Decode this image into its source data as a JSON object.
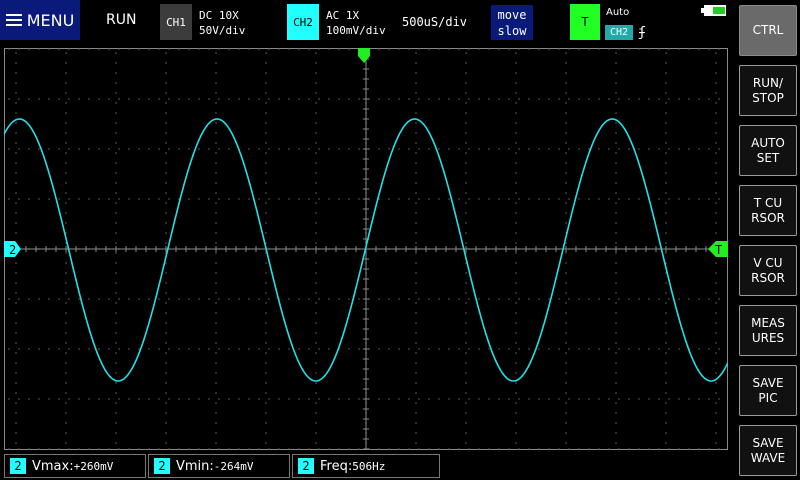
{
  "topbar": {
    "menu_label": "MENU",
    "run_state": "RUN",
    "ch1": {
      "label": "CH1",
      "coupling": "DC  10X",
      "scale": "50V/div"
    },
    "ch2": {
      "label": "CH2",
      "coupling": "AC  1X",
      "scale": "100mV/div"
    },
    "timebase": "500uS/div",
    "move_label_1": "move",
    "move_label_2": "slow",
    "trigger": {
      "label": "T",
      "mode": "Auto",
      "source": "CH2",
      "edge": "ʄ"
    },
    "battery_icon": "battery-icon"
  },
  "buttons": [
    {
      "l1": "CTRL",
      "l2": "",
      "active": true
    },
    {
      "l1": "RUN/",
      "l2": "STOP",
      "active": false
    },
    {
      "l1": "AUTO",
      "l2": "SET",
      "active": false
    },
    {
      "l1": "T CU",
      "l2": "RSOR",
      "active": false
    },
    {
      "l1": "V CU",
      "l2": "RSOR",
      "active": false
    },
    {
      "l1": "MEAS",
      "l2": "URES",
      "active": false
    },
    {
      "l1": "SAVE",
      "l2": "PIC",
      "active": false
    },
    {
      "l1": "SAVE",
      "l2": "WAVE",
      "active": false
    }
  ],
  "screen": {
    "ch2_marker": "2",
    "trigger_marker": "T",
    "waveform_color": "#22e0e8",
    "grid_color": "#5a5a5a",
    "trigger_color": "#22ee22",
    "waveform": {
      "frequency_hz": 506,
      "vmax_mv": 260,
      "vmin_mv": -264,
      "volts_per_div_mv": 100,
      "time_per_div_us": 500
    }
  },
  "measurements": [
    {
      "badge": "2",
      "label": "Vmax:",
      "value": "+260mV"
    },
    {
      "badge": "2",
      "label": "Vmin:",
      "value": "-264mV"
    },
    {
      "badge": "2",
      "label": "Freq:",
      "value": "506Hz"
    }
  ],
  "colors": {
    "accent": "#22ffff",
    "menu_bg": "#0a1a7a",
    "trigger": "#22ff22"
  }
}
